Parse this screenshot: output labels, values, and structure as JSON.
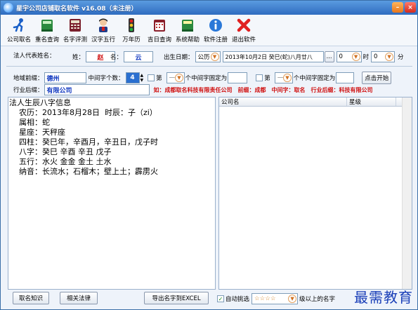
{
  "title": "星宇公司店铺取名软件 v16.08（未注册）",
  "toolbar": {
    "items": [
      {
        "label": "公司取名",
        "icon": "runner-icon"
      },
      {
        "label": "重名查询",
        "icon": "book-icon"
      },
      {
        "label": "名字评测",
        "icon": "calculator-icon"
      },
      {
        "label": "汉字五行",
        "icon": "person-icon"
      },
      {
        "label": "万年历",
        "icon": "traffic-light-icon"
      },
      {
        "label": "吉日查询",
        "icon": "calendar-icon"
      },
      {
        "label": "系统帮助",
        "icon": "help-book-icon"
      },
      {
        "label": "软件注册",
        "icon": "info-icon"
      },
      {
        "label": "退出软件",
        "icon": "exit-icon"
      }
    ]
  },
  "person": {
    "label": "法人代表姓名：",
    "surname_label": "姓：",
    "surname": "赵",
    "given_label": "名：",
    "given": "云",
    "birth_label": "出生日期：",
    "calendar_type": "公历",
    "birth_date": "2013年10月2日  癸巳(蛇)八月廿八",
    "more_btn": "...",
    "hour": "0",
    "hour_label": "时",
    "minute": "0",
    "minute_label": "分"
  },
  "naming": {
    "prefix_label": "地域前缀：",
    "prefix_value": "德州",
    "mid_count_label": "中间字个数：",
    "mid_count": "4",
    "fix1_label": "第",
    "fix1_pos": "一",
    "fix1_text": "个中间字固定为",
    "fix2_label": "第",
    "fix2_pos": "一",
    "fix2_text": "个中间字固定为",
    "start_btn": "点击开始",
    "suffix_label": "行业后缀：",
    "suffix_value": "有限公司",
    "example": "如：成都取名科技有限责任公司",
    "example_prefix": "前缀：成都",
    "example_mid": "中间字：取名",
    "example_suffix": "行业后缀：科技有限公司"
  },
  "bazi": {
    "heading": "法人生辰八字信息",
    "lines": [
      "    农历：2013年8月28日  时辰：子（zi）",
      "    属相：蛇",
      "    星座：天秤座",
      "    四柱：癸巳年，辛酉月，辛丑日，戊子时",
      "    八字：癸巳 辛酉 辛丑 戊子",
      "    五行：水火 金金 金土 土水",
      "    纳音：长流水；石榴木；壁上土；霹雳火"
    ]
  },
  "results": {
    "col_name": "公司名",
    "col_star": "星级"
  },
  "footer": {
    "btn_knowledge": "取名知识",
    "btn_law": "相关法律",
    "btn_export": "导出名字到EXCEL",
    "auto_label": "自动挑选",
    "stars": "☆☆☆☆",
    "auto_suffix": "级以上的名字"
  },
  "watermark": "最需教育"
}
